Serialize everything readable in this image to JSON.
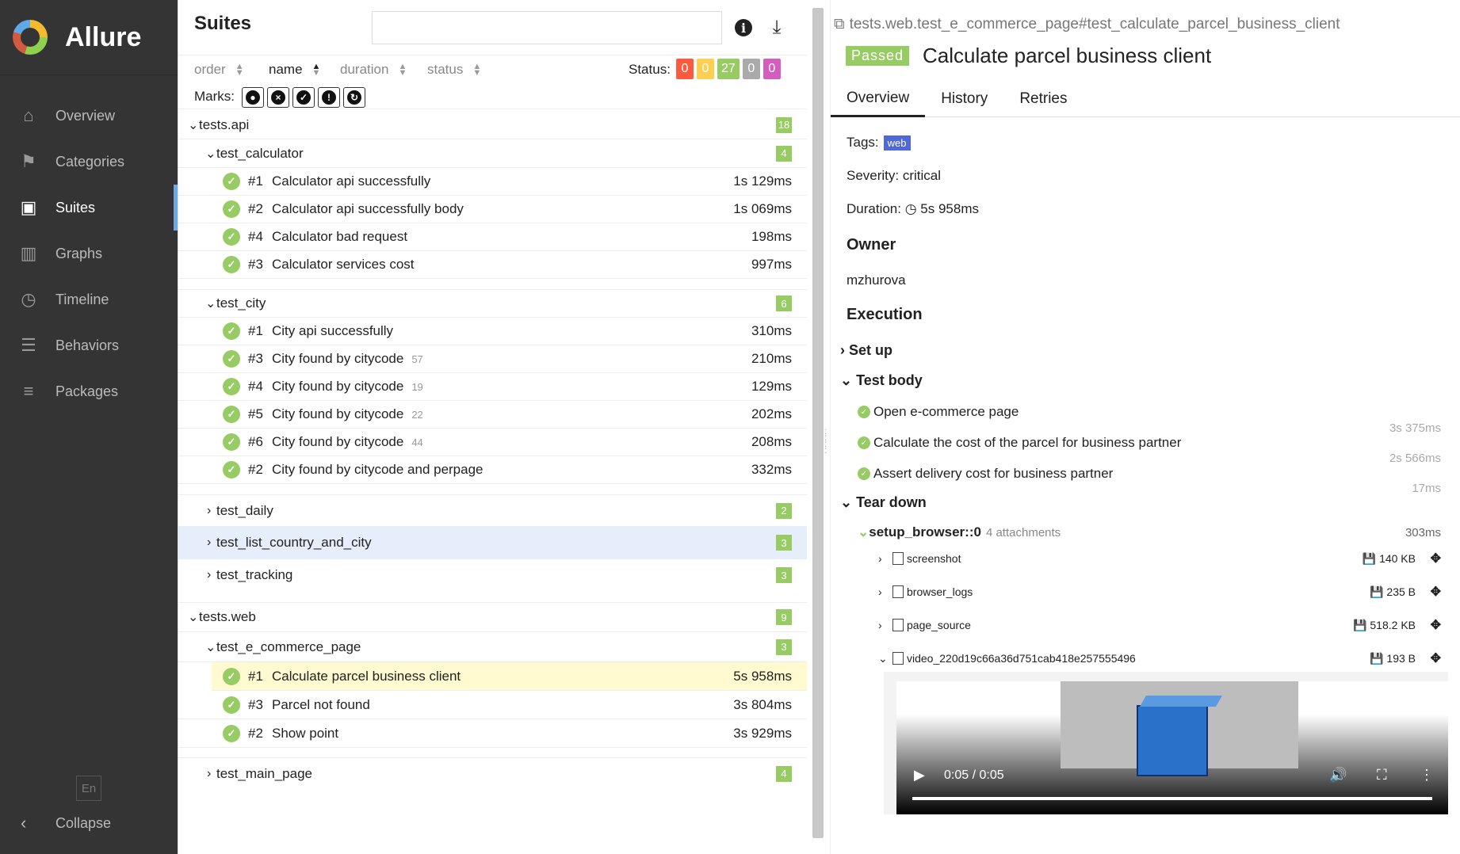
{
  "app": {
    "name": "Allure",
    "lang": "En",
    "collapse_label": "Collapse"
  },
  "nav": [
    {
      "label": "Overview",
      "icon": "home-icon"
    },
    {
      "label": "Categories",
      "icon": "flag-icon"
    },
    {
      "label": "Suites",
      "icon": "briefcase-icon"
    },
    {
      "label": "Graphs",
      "icon": "bar-chart-icon"
    },
    {
      "label": "Timeline",
      "icon": "clock-icon"
    },
    {
      "label": "Behaviors",
      "icon": "list-icon"
    },
    {
      "label": "Packages",
      "icon": "align-left-icon"
    }
  ],
  "suites": {
    "title": "Suites",
    "search_placeholder": "",
    "sort": {
      "order": "order",
      "name": "name",
      "duration": "duration",
      "status": "status"
    },
    "status_label": "Status:",
    "status_counts": [
      {
        "value": "0",
        "color": "#fd5a3e"
      },
      {
        "value": "0",
        "color": "#ffd050"
      },
      {
        "value": "27",
        "color": "#97cc64"
      },
      {
        "value": "0",
        "color": "#aaaaaa"
      },
      {
        "value": "0",
        "color": "#d35ebe"
      }
    ],
    "marks_label": "Marks:"
  },
  "tree": {
    "api": {
      "name": "tests.api",
      "count": "18"
    },
    "calculator": {
      "name": "test_calculator",
      "count": "4",
      "cases": [
        {
          "num": "#1",
          "name": "Calculator api successfully",
          "dur": "1s 129ms"
        },
        {
          "num": "#2",
          "name": "Calculator api successfully body",
          "dur": "1s 069ms"
        },
        {
          "num": "#4",
          "name": "Calculator bad request",
          "dur": "198ms"
        },
        {
          "num": "#3",
          "name": "Calculator services cost",
          "dur": "997ms"
        }
      ]
    },
    "city": {
      "name": "test_city",
      "count": "6",
      "cases": [
        {
          "num": "#1",
          "name": "City api successfully",
          "sub": "",
          "dur": "310ms"
        },
        {
          "num": "#3",
          "name": "City found by citycode",
          "sub": "57",
          "dur": "210ms"
        },
        {
          "num": "#4",
          "name": "City found by citycode",
          "sub": "19",
          "dur": "129ms"
        },
        {
          "num": "#5",
          "name": "City found by citycode",
          "sub": "22",
          "dur": "202ms"
        },
        {
          "num": "#6",
          "name": "City found by citycode",
          "sub": "44",
          "dur": "208ms"
        },
        {
          "num": "#2",
          "name": "City found by citycode and perpage",
          "sub": "",
          "dur": "332ms"
        }
      ]
    },
    "daily": {
      "name": "test_daily",
      "count": "2"
    },
    "list_country": {
      "name": "test_list_country_and_city",
      "count": "3"
    },
    "tracking": {
      "name": "test_tracking",
      "count": "3"
    },
    "web": {
      "name": "tests.web",
      "count": "9"
    },
    "ecommerce": {
      "name": "test_e_commerce_page",
      "count": "3",
      "cases": [
        {
          "num": "#1",
          "name": "Calculate parcel business client",
          "dur": "5s 958ms"
        },
        {
          "num": "#3",
          "name": "Parcel not found",
          "dur": "3s 804ms"
        },
        {
          "num": "#2",
          "name": "Show point",
          "dur": "3s 929ms"
        }
      ]
    },
    "main_page": {
      "name": "test_main_page",
      "count": "4"
    }
  },
  "detail": {
    "breadcrumb": "tests.web.test_e_commerce_page#test_calculate_parcel_business_client",
    "status": "Passed",
    "title": "Calculate parcel business client",
    "tabs": [
      "Overview",
      "History",
      "Retries"
    ],
    "tags_label": "Tags:",
    "tag": "web",
    "severity": "Severity: critical",
    "duration_label": "Duration:",
    "duration": "5s 958ms",
    "owner_heading": "Owner",
    "owner": "mzhurova",
    "execution_heading": "Execution",
    "setup_label": "Set up",
    "body_label": "Test body",
    "steps": [
      {
        "name": "Open e-commerce page",
        "dur": "3s 375ms"
      },
      {
        "name": "Calculate the cost of the parcel for business partner",
        "dur": "2s 566ms"
      },
      {
        "name": "Assert delivery cost for business partner",
        "dur": "17ms"
      }
    ],
    "teardown_label": "Tear down",
    "fixture": {
      "name": "setup_browser::0",
      "sub": "4 attachments",
      "dur": "303ms"
    },
    "attachments": [
      {
        "name": "screenshot",
        "size": "140 KB"
      },
      {
        "name": "browser_logs",
        "size": "235 B"
      },
      {
        "name": "page_source",
        "size": "518.2 KB"
      },
      {
        "name": "video_220d19c66a36d751cab418e257555496",
        "size": "193 B"
      }
    ],
    "video_time": "0:05 / 0:05"
  }
}
